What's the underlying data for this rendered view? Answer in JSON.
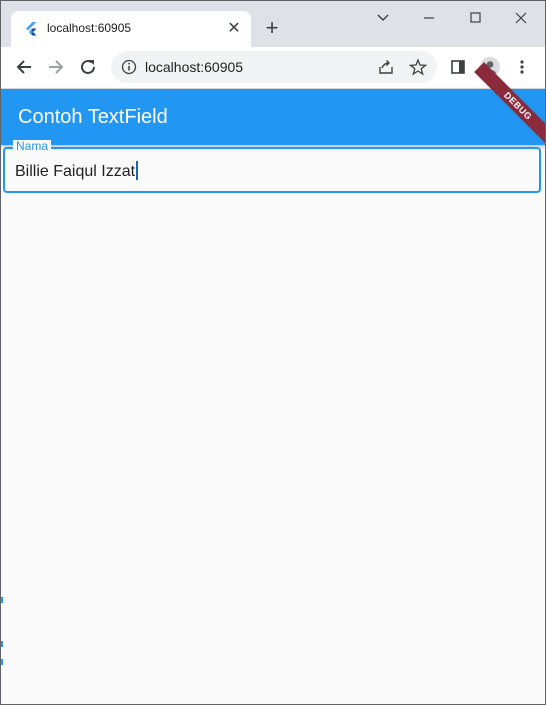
{
  "browser": {
    "tab_title": "localhost:60905",
    "url": "localhost:60905"
  },
  "app": {
    "title": "Contoh TextField",
    "debug_banner": "DEBUG",
    "field": {
      "label": "Nama",
      "value": "Billie Faiqul Izzat"
    }
  },
  "icons": {
    "tab_favicon": "flutter-icon",
    "tab_close": "close-icon",
    "new_tab": "plus-icon",
    "minimize": "minimize-icon",
    "maximize": "maximize-icon",
    "close_window": "close-icon",
    "tab_search": "chevron-down-icon",
    "back": "back-arrow-icon",
    "forward": "forward-arrow-icon",
    "reload": "reload-icon",
    "site_info": "info-icon",
    "share": "share-icon",
    "bookmark": "star-icon",
    "side_panel": "side-panel-icon",
    "profile": "profile-icon",
    "menu": "more-vert-icon"
  },
  "colors": {
    "primary": "#2196f3",
    "debug_banner": "#8b2a3a",
    "tabstrip": "#dee1e6"
  }
}
